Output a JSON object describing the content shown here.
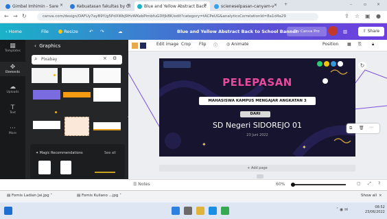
{
  "browser": {
    "tabs": [
      {
        "label": "Gimbal Imhimin - Sare"
      },
      {
        "label": "Kebuatasan fakultas by Gl"
      },
      {
        "label": "Blue and Yellow Abstract Back"
      },
      {
        "label": "scieneselpasan-canyam-v"
      }
    ],
    "url": "canva.com/design/DAFUy7ayB9Y/g5PdXWbJ9HzWKebPimbfuG0lfjkBK/edit?category=tACPeUG&analyticsCorrelationId=8a1d4a29"
  },
  "topbar": {
    "home": "Home",
    "file": "File",
    "resize": "Resize",
    "title": "Blue and Yellow Abstract Back to School Banner",
    "print": "Try Canva Pro",
    "share": "Share"
  },
  "context_bar": {
    "edit_image": "Edit image",
    "crop": "Crop",
    "flip": "Flip",
    "animate": "Animate",
    "position": "Position"
  },
  "rail": {
    "items": [
      {
        "label": "Templates",
        "icon": "templates-icon"
      },
      {
        "label": "Elements",
        "icon": "elements-icon"
      },
      {
        "label": "Uploads",
        "icon": "uploads-icon"
      },
      {
        "label": "Text",
        "icon": "text-icon"
      },
      {
        "label": "More",
        "icon": "more-icon"
      }
    ]
  },
  "panel": {
    "back": "Graphics",
    "search_value": "Pixabay",
    "recommend_label": "Magic Recommendations",
    "see_all": "See all"
  },
  "slide": {
    "heading": "PELEPASAN",
    "banner": "MAHASISWA KAMPUS MENGAJAR  ANGKATAN 3",
    "from": "DARI",
    "school": "SD Negeri SIDOREJO 01",
    "date": "23 Juni 2022"
  },
  "canvas": {
    "add_page": "+ Add page",
    "notes": "Notes",
    "zoom": "60%"
  },
  "downloads": {
    "items": [
      {
        "label": "Fomis Ladian Jai.jpg"
      },
      {
        "label": "Fomis Kuliano ...jpg"
      }
    ],
    "show_all": "Show all"
  },
  "taskbar": {
    "time": "08:52",
    "date": "23/06/2022"
  },
  "colors": {
    "accent": "#5b4fd6",
    "teal": "#1ab2c9",
    "slide_bg": "#16142f",
    "heading_pink": "#e84a9e"
  }
}
